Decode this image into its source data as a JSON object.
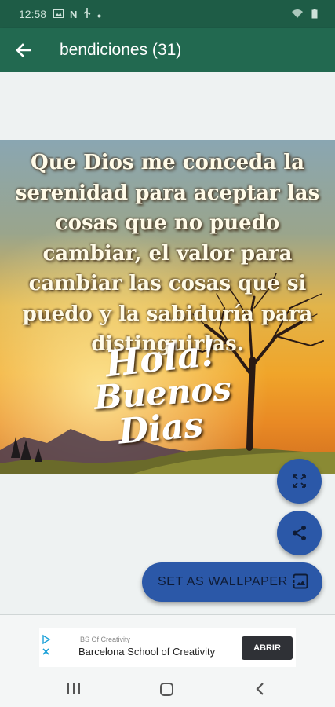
{
  "status_bar": {
    "time": "12:58",
    "left_icons": [
      "image-icon",
      "n-icon",
      "usb-icon",
      "dot-icon"
    ],
    "right_icons": [
      "mute-icon",
      "wifi-icon",
      "signal-icon",
      "battery-icon"
    ]
  },
  "app_bar": {
    "back_icon": "arrow-left-icon",
    "title": "bendiciones (31)"
  },
  "image": {
    "quote": "Que Dios me conceda la serenidad para aceptar las cosas que no puedo cambiar, el valor para cambiar las cosas que si puedo y la sabiduría para distinguirlas.",
    "greeting_line1": "Hola!",
    "greeting_line2": "Buenos",
    "greeting_line3": "Dias"
  },
  "actions": {
    "expand_icon": "fullscreen-icon",
    "share_icon": "share-icon",
    "set_wallpaper_label": "SET AS WALLPAPER",
    "wallpaper_icon": "wallpaper-icon"
  },
  "ad": {
    "advertiser": "BS Of Creativity",
    "headline": "Barcelona School of Creativity",
    "cta": "ABRIR"
  },
  "nav_bar": {
    "icons": [
      "recents-icon",
      "home-icon",
      "back-icon"
    ]
  },
  "colors": {
    "status_bar": "#1e5c46",
    "app_bar": "#226950",
    "fab": "#2b58a8",
    "background": "#eef2f2"
  }
}
